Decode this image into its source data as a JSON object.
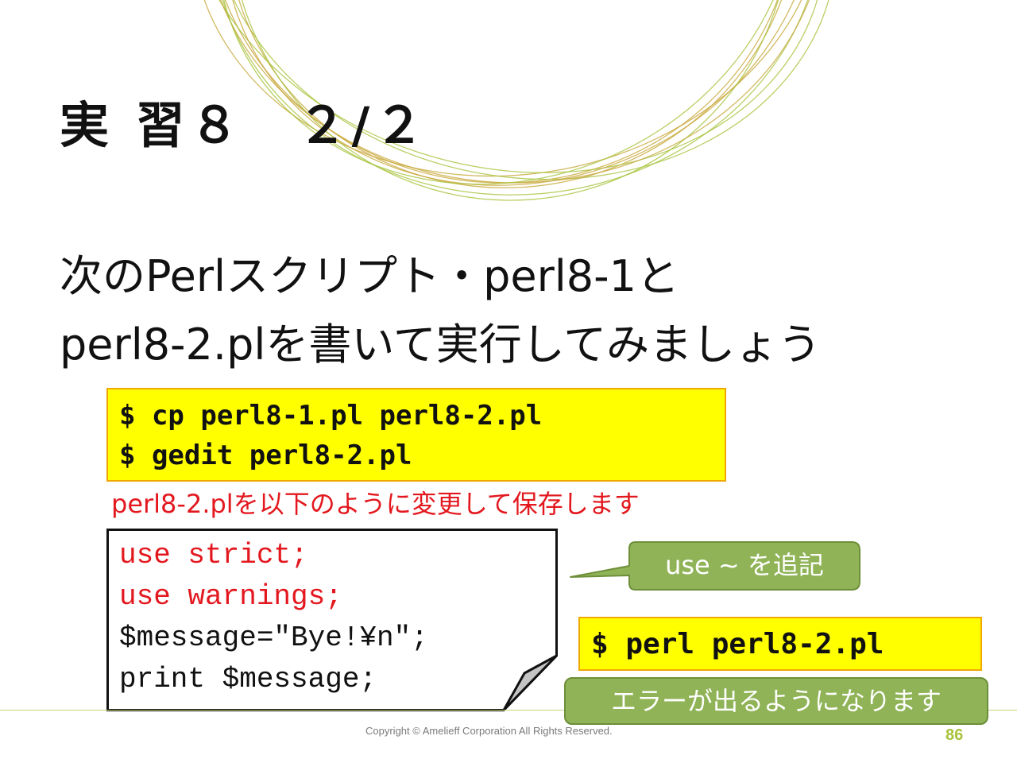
{
  "slide": {
    "title": "実 習８　２/２",
    "intro_line1": "次のPerlスクリプト・perl8-1と",
    "intro_line2": "perl8-2.plを書いて実行してみましょう",
    "commands": [
      "$ cp perl8-1.pl perl8-2.pl",
      "$ gedit perl8-2.pl"
    ],
    "edit_note": "perl8-2.plを以下のように変更して保存します",
    "code_lines": [
      {
        "text": "use strict;",
        "style": "kw"
      },
      {
        "text": "use warnings;",
        "style": "kw"
      },
      {
        "text": "$message=\"Bye!¥n\";",
        "style": "plain"
      },
      {
        "text": "print $message;",
        "style": "plain"
      }
    ],
    "callout": "use ~ を追記",
    "run_command": "$ perl perl8-2.pl",
    "error_note": "エラーが出るようになります"
  },
  "footer": {
    "copyright": "Copyright © Amelieff Corporation All Rights Reserved.",
    "page_number": "86"
  },
  "colors": {
    "accent_red": "#e3181f",
    "highlight_yellow": "#ffff00",
    "badge_green": "#8fb356",
    "decor_gold": "#c8a83a",
    "decor_green": "#a8c33c"
  }
}
